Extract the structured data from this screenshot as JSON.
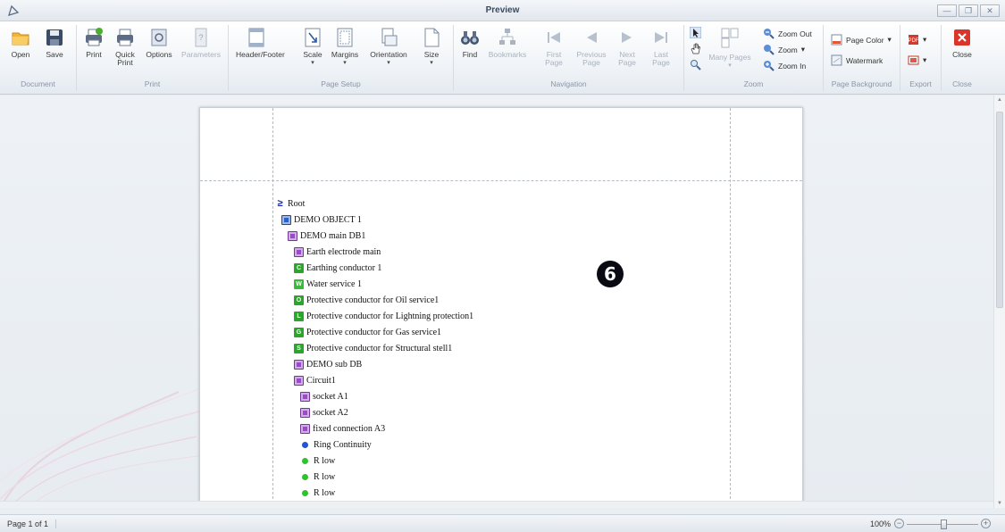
{
  "window": {
    "title": "Preview"
  },
  "ribbon": {
    "document": {
      "label": "Document",
      "open": "Open",
      "save": "Save"
    },
    "print": {
      "label": "Print",
      "print": "Print",
      "quick_print": "Quick Print",
      "options": "Options",
      "parameters": "Parameters"
    },
    "page_setup": {
      "label": "Page Setup",
      "header_footer": "Header/Footer",
      "scale": "Scale",
      "margins": "Margins",
      "orientation": "Orientation",
      "size": "Size"
    },
    "navigation": {
      "label": "Navigation",
      "find": "Find",
      "bookmarks": "Bookmarks",
      "first_page": "First Page",
      "previous_page": "Previous Page",
      "next_page": "Next Page",
      "last_page": "Last Page"
    },
    "zoom": {
      "label": "Zoom",
      "many_pages": "Many Pages",
      "zoom_out": "Zoom Out",
      "zoom": "Zoom",
      "zoom_in": "Zoom In"
    },
    "page_background": {
      "label": "Page Background",
      "page_color": "Page Color",
      "watermark": "Watermark"
    },
    "export": {
      "label": "Export"
    },
    "close": {
      "label": "Close",
      "close": "Close"
    }
  },
  "report": {
    "marker": "6",
    "nodes": [
      {
        "text": "Root",
        "icon": "root-arrow-icon",
        "color": "#1a2bb8",
        "glyph": ""
      },
      {
        "text": "DEMO OBJECT 1",
        "icon": "object-icon",
        "color": "#2b62c9",
        "glyph": ""
      },
      {
        "text": "DEMO main DB1",
        "icon": "distribution-board-icon",
        "color": "#9a4bc8",
        "glyph": ""
      },
      {
        "text": "Earth  electrode main",
        "icon": "earth-electrode-icon",
        "color": "#9a4bc8",
        "glyph": ""
      },
      {
        "text": "Earthing conductor 1",
        "icon": "conductor-c-icon",
        "color": "#2da52d",
        "glyph": "C"
      },
      {
        "text": "Water service 1",
        "icon": "conductor-w-icon",
        "color": "#3cb83c",
        "glyph": "W"
      },
      {
        "text": "Protective conductor for Oil service1",
        "icon": "conductor-o-icon",
        "color": "#2da52d",
        "glyph": "O"
      },
      {
        "text": "Protective conductor for Lightning protection1",
        "icon": "conductor-l-icon",
        "color": "#2da52d",
        "glyph": "L"
      },
      {
        "text": "Protective conductor for Gas service1",
        "icon": "conductor-g-icon",
        "color": "#2da52d",
        "glyph": "G"
      },
      {
        "text": "Protective conductor for Structural stell1",
        "icon": "conductor-s-icon",
        "color": "#2da52d",
        "glyph": "S"
      },
      {
        "text": "DEMO sub DB",
        "icon": "sub-db-icon",
        "color": "#9a4bc8",
        "glyph": ""
      },
      {
        "text": "Circuit1",
        "icon": "circuit-icon",
        "color": "#9a4bc8",
        "glyph": ""
      },
      {
        "text": "socket A1",
        "icon": "socket-icon",
        "color": "#9a4bc8",
        "glyph": ""
      },
      {
        "text": "socket A2",
        "icon": "socket-icon",
        "color": "#9a4bc8",
        "glyph": ""
      },
      {
        "text": "fixed connection A3",
        "icon": "fixed-connection-icon",
        "color": "#9a4bc8",
        "glyph": ""
      },
      {
        "text": "Ring Continuity",
        "icon": "blue-dot-icon",
        "color": "#2454d6",
        "glyph": ""
      },
      {
        "text": "R low",
        "icon": "green-dot-icon",
        "color": "#2fc22f",
        "glyph": ""
      },
      {
        "text": "R low",
        "icon": "green-dot-icon",
        "color": "#2fc22f",
        "glyph": ""
      },
      {
        "text": "R low",
        "icon": "green-dot-icon",
        "color": "#2fc22f",
        "glyph": ""
      }
    ]
  },
  "status": {
    "page": "Page 1 of 1",
    "zoom": "100%"
  }
}
